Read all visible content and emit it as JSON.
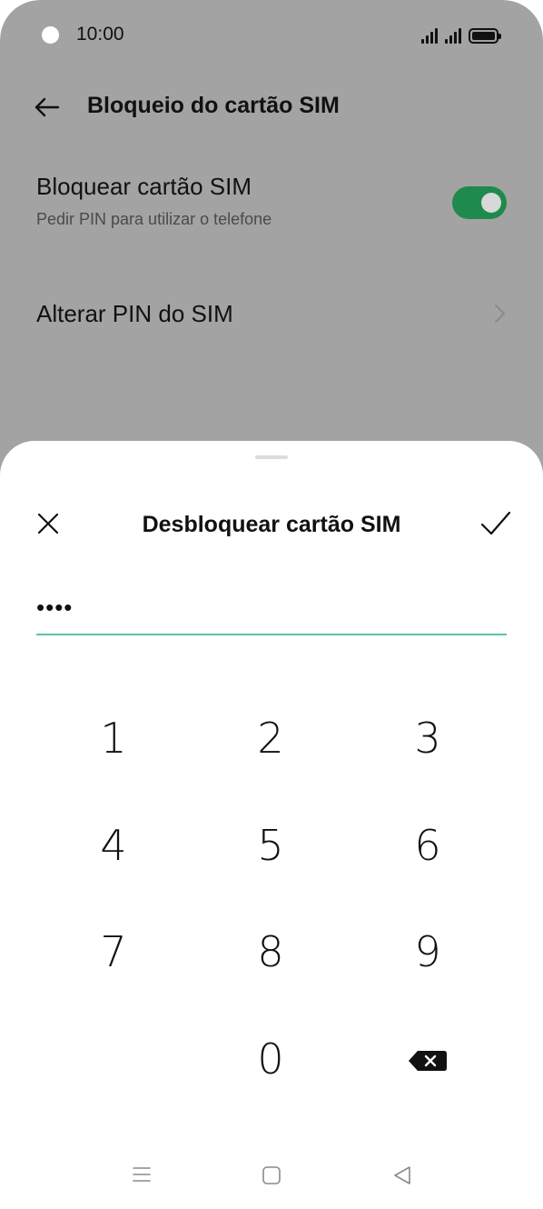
{
  "status_bar": {
    "time": "10:00"
  },
  "app_bar": {
    "title": "Bloqueio do cartão SIM"
  },
  "settings": {
    "lock_sim": {
      "title": "Bloquear cartão SIM",
      "subtitle": "Pedir PIN para utilizar o telefone",
      "enabled": true
    },
    "change_pin": {
      "title": "Alterar PIN do SIM"
    }
  },
  "dialog": {
    "title": "Desbloquear cartão SIM",
    "pin_value": "••••"
  },
  "keypad": {
    "keys": [
      "1",
      "2",
      "3",
      "4",
      "5",
      "6",
      "7",
      "8",
      "9",
      "0"
    ]
  },
  "colors": {
    "accent": "#1e8a4c",
    "field_underline": "#5cc4a0",
    "dim_overlay": "#a3a3a3"
  },
  "icons": {
    "back": "arrow-left-icon",
    "chevron": "chevron-right-icon",
    "close": "close-icon",
    "confirm": "check-icon",
    "backspace": "backspace-icon",
    "nav_menu": "menu-icon",
    "nav_home": "home-icon",
    "nav_back": "triangle-back-icon"
  }
}
